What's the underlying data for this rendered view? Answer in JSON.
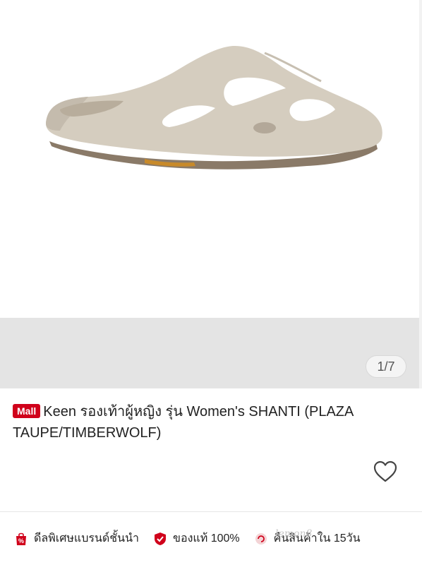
{
  "gallery": {
    "counter": "1/7",
    "colors": {
      "upper_bg": "#ffffff",
      "lower_bg": "#e4e4e4"
    }
  },
  "product": {
    "badge": "Mall",
    "title": "Keen รองเท้าผู้หญิง รุ่น Women's SHANTI (PLAZA TAUPE/TIMBERWOLF)",
    "favorite_icon": "heart-outline-icon"
  },
  "features": [
    {
      "icon": "shopping-bag-percent-icon",
      "label": "ดีลพิเศษแบรนด์ชั้นนำ"
    },
    {
      "icon": "shield-check-icon",
      "label": "ของแท้ 100%"
    },
    {
      "icon": "return-icon",
      "label": "คืนสินค้าใน 15วัน"
    }
  ],
  "watermark": "lemon8",
  "accent_color": "#d0011b"
}
